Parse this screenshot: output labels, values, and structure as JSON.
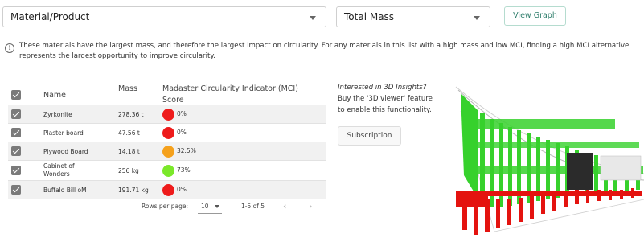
{
  "selectors": {
    "category": "Material/Product",
    "metric": "Total Mass",
    "view_graph": "View Graph"
  },
  "info": {
    "icon": "info-icon",
    "text": "These materials have the largest mass, and therefore the largest impact on circularity. For any materials in this list with a high mass and low MCI, finding a high MCI alternative represents the largest opportunity to improve circularity."
  },
  "table": {
    "columns": {
      "name": "Name",
      "mass": "Mass",
      "mci": "Madaster Circularity Indicator (MCI)",
      "score": "Score"
    },
    "rows": [
      {
        "name": "Zyrkonite",
        "mass": "278.36 t",
        "score": "0%",
        "color": "#ee1b1b"
      },
      {
        "name": "Plaster board",
        "mass": "47.56 t",
        "score": "0%",
        "color": "#ee1b1b"
      },
      {
        "name": "Plywood Board",
        "mass": "14.18 t",
        "score": "32.5%",
        "color": "#f5a11c"
      },
      {
        "name": "Cabinet of Wonders",
        "mass": "256 kg",
        "score": "73%",
        "color": "#7be82a"
      },
      {
        "name": "Buffalo Bill oM",
        "mass": "191.71 kg",
        "score": "0%",
        "color": "#ee1b1b"
      }
    ]
  },
  "pagination": {
    "rows_per_page_label": "Rows per page:",
    "rows_per_page": "10",
    "range": "1-5 of 5",
    "prev": "‹",
    "next": "›"
  },
  "promo": {
    "heading": "Interested in 3D Insights?",
    "line1": "Buy the '3D viewer' feature",
    "line2": "to enable this functionality.",
    "button": "Subscription"
  },
  "model_preview": {
    "icon": "building-3d-model-icon"
  }
}
